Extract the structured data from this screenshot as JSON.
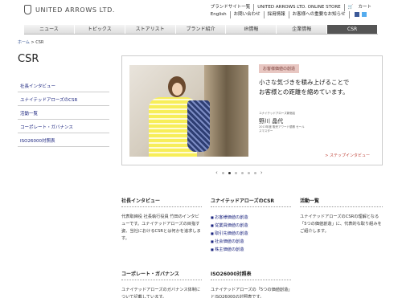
{
  "header": {
    "logo_text": "UNITED ARROWS LTD.",
    "links_row1": [
      "ブランドサイト一覧",
      "UNITED ARROWS LTD. ONLINE STORE",
      "カート"
    ],
    "links_row2": [
      "English",
      "お問い合わせ",
      "採用情報",
      "お客様への重要なお知らせ"
    ],
    "social_colors": [
      "#3b5998",
      "#55acee"
    ]
  },
  "nav": {
    "items": [
      "ニュース",
      "トピックス",
      "ストアリスト",
      "ブランド紹介",
      "IR情報",
      "企業情報",
      "CSR"
    ],
    "active_index": 6
  },
  "breadcrumb": {
    "home": "ホーム",
    "sep": ">",
    "current": "CSR"
  },
  "page_title": "CSR",
  "sidebar": {
    "items": [
      "社長インタビュー",
      "ユナイテッドアローズのCSR",
      "活動一覧",
      "コーポレート・ガバナンス",
      "ISO26000対照表"
    ]
  },
  "hero": {
    "tag": "お客様価値の創造",
    "quote_line1": "小さな気づきを積み上げることで",
    "quote_line2": "お客様との距離を縮めています。",
    "staff_small": "ユナイテッドアローズ新宿店",
    "staff_name": "野川 晶代",
    "staff_sub": "2013年度 販売アワード優勝 セールスマスター",
    "link": "> ステップインタビュー"
  },
  "carousel": {
    "prev": "‹",
    "next": "›",
    "dots": 6,
    "active": 1
  },
  "sections": {
    "president": {
      "title": "社長インタビュー",
      "body": "代表取締役 社長執行役員 竹田のインタビューです。ユナイテッドアローズの目指す姿、当社におけるCSRとは何かを追求します。"
    },
    "csr": {
      "title": "ユナイテッドアローズのCSR",
      "items": [
        "お客様価値の創造",
        "従業員価値の創造",
        "取引先価値の創造",
        "社会価値の創造",
        "株主価値の創造"
      ]
    },
    "activities": {
      "title": "活動一覧",
      "body": "ユナイテッドアローズのCSRの理解となる「5つの価値創造」に、代表的な取り組みをご紹介します。"
    },
    "governance": {
      "title": "コーポレート・ガバナンス",
      "body": "ユナイテッドアローズのガバナンス体制について記載しています。"
    },
    "iso": {
      "title": "ISO26000対照表",
      "body": "ユナイテッドアローズの「5つの価値創造」とISO26000の対照表です。"
    }
  }
}
